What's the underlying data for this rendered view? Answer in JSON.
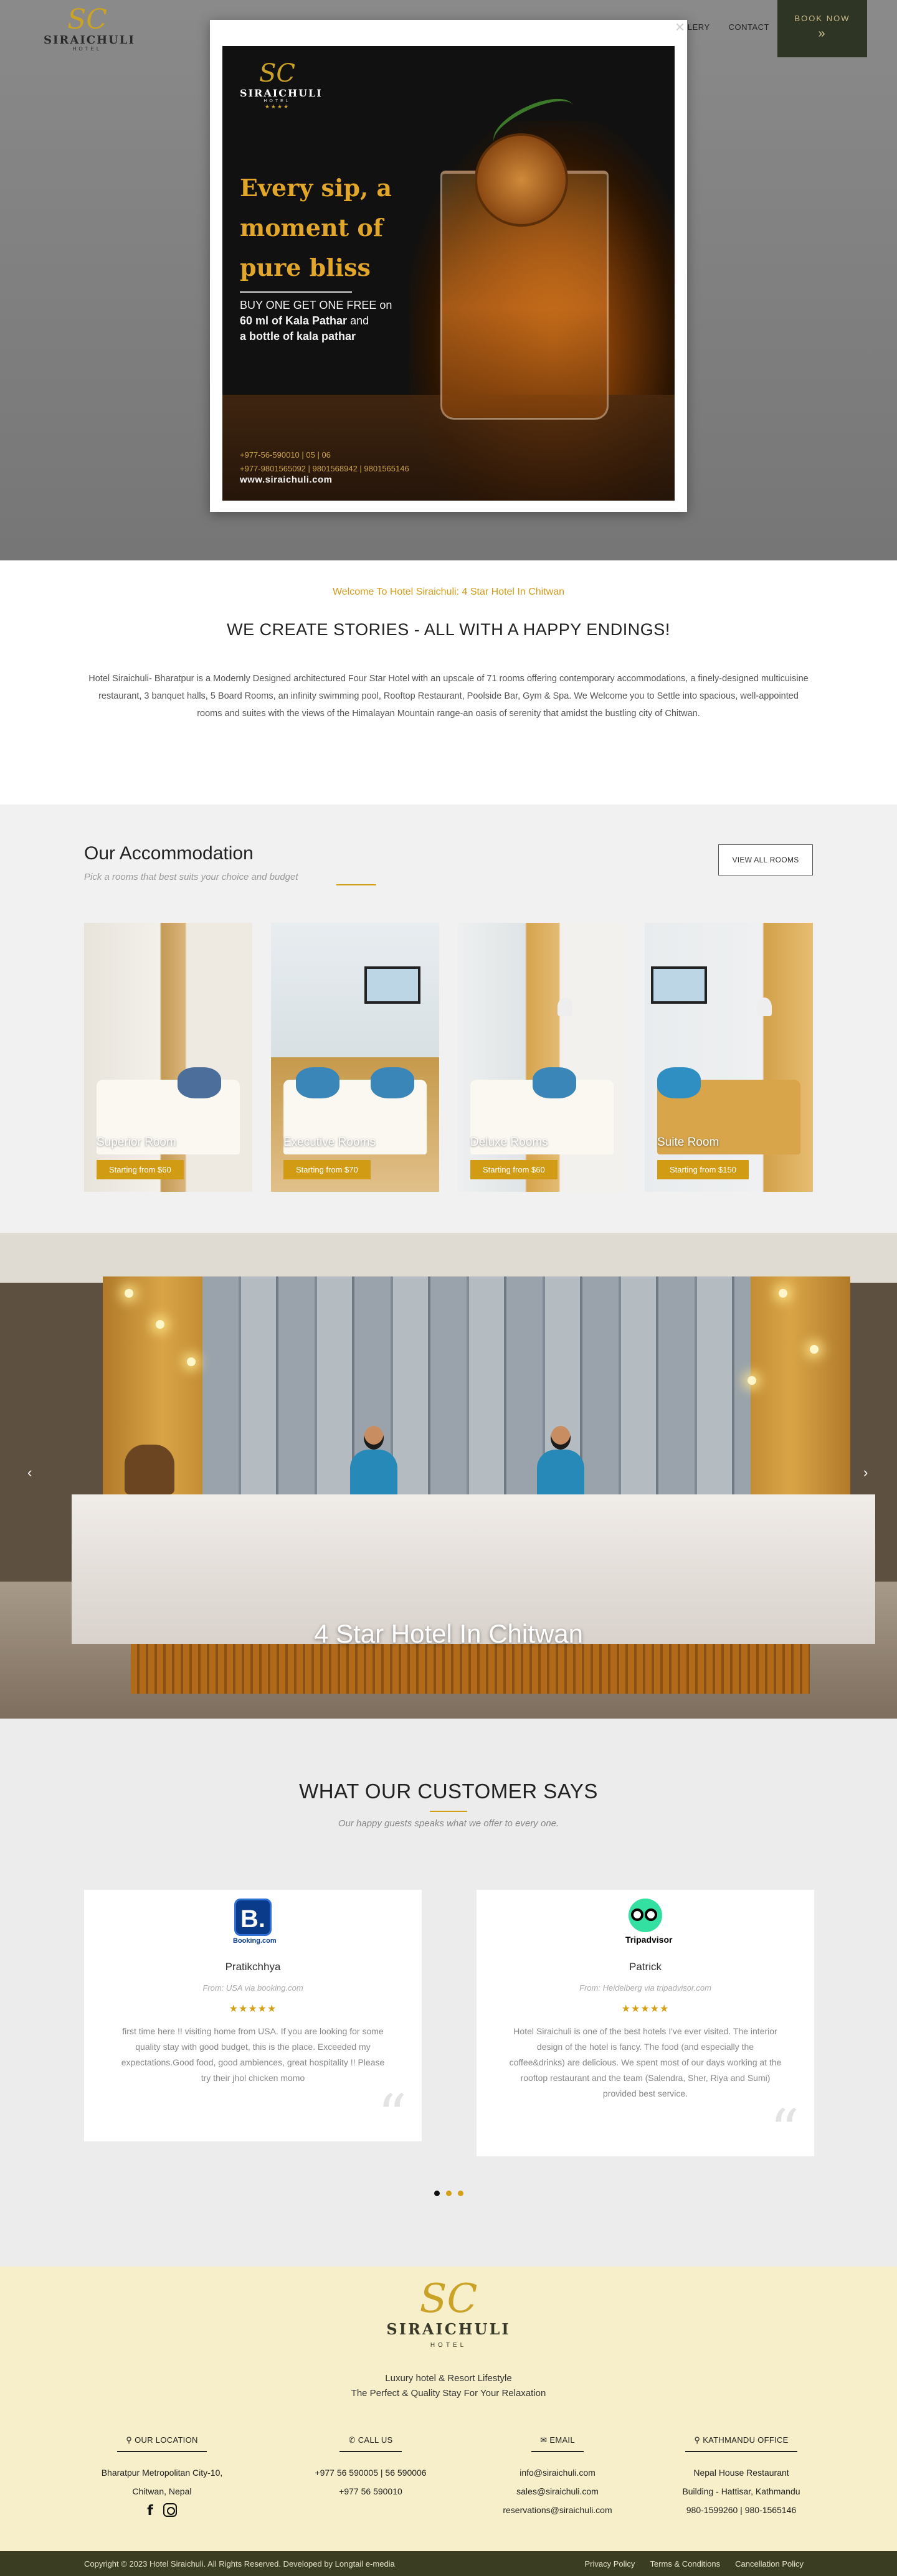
{
  "header": {
    "logo": {
      "brand": "SIRAICHULI",
      "sub": "HOTEL"
    },
    "nav": [
      "LERY",
      "CONTACT"
    ],
    "book_now": "BOOK NOW",
    "book_now_icon": "double-chevron-down-icon"
  },
  "popup": {
    "close": "×",
    "logo": {
      "brand": "SIRAICHULI",
      "sub": "HOTEL",
      "stars": "★★★★"
    },
    "headline": "Every sip, a moment of pure bliss",
    "offer_line1": "BUY ONE GET ONE FREE on",
    "offer_line2_bold": "60 ml of Kala Pathar",
    "offer_line2_rest": " and",
    "offer_line3": "a bottle of kala pathar",
    "phone1": "+977-56-590010 | 05 | 06",
    "phone2": "+977-9801565092 | 9801568942 | 9801565146",
    "website": "www.siraichuli.com"
  },
  "welcome": {
    "kicker": "Welcome To Hotel Siraichuli: 4 Star Hotel In Chitwan",
    "heading": "WE CREATE STORIES - ALL WITH A HAPPY ENDINGS!",
    "paragraph": "Hotel Siraichuli- Bharatpur is a Modernly Designed architectured Four Star Hotel with an upscale of 71 rooms offering contemporary accommodations, a finely-designed multicuisine restaurant, 3 banquet halls, 5 Board Rooms, an infinity swimming pool, Rooftop Restaurant, Poolside Bar, Gym & Spa.  We Welcome you to Settle into spacious, well-appointed rooms and suites with the views of the Himalayan Mountain range-an oasis of serenity that amidst the bustling city of Chitwan."
  },
  "accommodation": {
    "title": "Our Accommodation",
    "subtitle": "Pick a rooms that best suits your choice and budget",
    "view_all": "VIEW ALL ROOMS",
    "rooms": [
      {
        "name": "Superior Room",
        "price": "Starting from $60"
      },
      {
        "name": "Executive Rooms",
        "price": "Starting from $70"
      },
      {
        "name": "Deluxe Rooms",
        "price": "Starting from $60"
      },
      {
        "name": "Suite Room",
        "price": "Starting from $150"
      }
    ]
  },
  "slider": {
    "caption": "4 Star Hotel In Chitwan",
    "prev": "‹",
    "next": "›"
  },
  "testimonials": {
    "title": "WHAT OUR CUSTOMER SAYS",
    "subtitle": "Our happy guests speaks what we offer to every one.",
    "items": [
      {
        "source_logo": "B.",
        "source_word": "Booking.com",
        "name": "Pratikchhya",
        "from": "From: USA via booking.com",
        "stars": "★★★★★",
        "text": "first time here !! visiting home from USA. If you are looking for some quality stay with good budget, this is the place. Exceeded my expectations.Good food, good ambiences, great hospitality !! Please try their jhol chicken momo",
        "quote": "“"
      },
      {
        "source_logo": "",
        "source_word": "Tripadvisor",
        "name": "Patrick",
        "from": "From: Heidelberg via tripadvisor.com",
        "stars": "★★★★★",
        "text": "Hotel Siraichuli is one of the best hotels I've ever visited. The interior design of the hotel is fancy. The food (and especially the coffee&drinks) are delicious. We spent most of our days working at the rooftop restaurant and the team (Salendra, Sher, Riya and Sumi) provided best service.",
        "quote": "“"
      }
    ],
    "dots_active_index": 0
  },
  "footer": {
    "logo": {
      "brand": "SIRAICHULI",
      "sub": "HOTEL"
    },
    "tagline1": "Luxury hotel & Resort Lifestyle",
    "tagline2": "The Perfect & Quality Stay For Your Relaxation",
    "columns": [
      {
        "icon": "map-marker-icon",
        "glyph": "⚲",
        "title": "OUR LOCATION",
        "lines": [
          "Bharatpur Metropolitan City-10,",
          "Chitwan, Nepal"
        ]
      },
      {
        "icon": "phone-icon",
        "glyph": "✆",
        "title": "CALL US",
        "lines": [
          "+977 56 590005 | 56 590006",
          "+977 56 590010"
        ]
      },
      {
        "icon": "envelope-icon",
        "glyph": "✉",
        "title": "EMAIL",
        "lines": [
          "info@siraichuli.com",
          "sales@siraichuli.com",
          "reservations@siraichuli.com"
        ]
      },
      {
        "icon": "map-marker-icon",
        "glyph": "⚲",
        "title": "KATHMANDU OFFICE",
        "lines": [
          "Nepal House Restaurant",
          "Building - Hattisar, Kathmandu",
          "980-1599260 | 980-1565146"
        ]
      }
    ],
    "copyright": "Copyright © 2023 Hotel Siraichuli. All Rights Reserved. Developed by Longtail e-media",
    "links": [
      "Privacy Policy",
      "Terms & Conditions",
      "Cancellation Policy"
    ]
  }
}
